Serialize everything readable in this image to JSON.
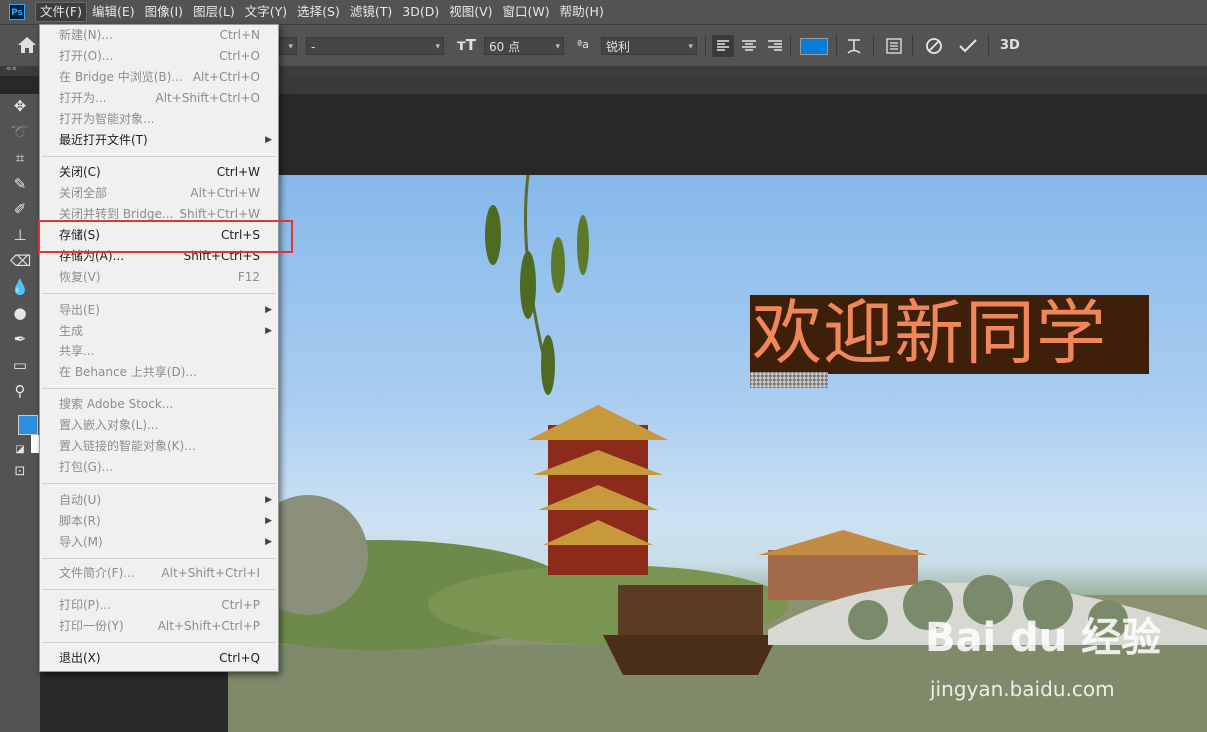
{
  "app": {
    "logo_text": "Ps"
  },
  "menubar": {
    "items": [
      "文件(F)",
      "编辑(E)",
      "图像(I)",
      "图层(L)",
      "文字(Y)",
      "选择(S)",
      "滤镜(T)",
      "3D(D)",
      "视图(V)",
      "窗口(W)",
      "帮助(H)"
    ]
  },
  "options_bar": {
    "font_style_value": "-",
    "font_size_value": "60 点",
    "aa_label": "ªa",
    "antialias_value": "锐利",
    "threed_label": "3D",
    "text_color": "#0a7bd4"
  },
  "file_menu": {
    "items": [
      {
        "label": "新建(N)...",
        "shortcut": "Ctrl+N",
        "enabled": false
      },
      {
        "label": "打开(O)...",
        "shortcut": "Ctrl+O",
        "enabled": false
      },
      {
        "label": "在 Bridge 中浏览(B)...",
        "shortcut": "Alt+Ctrl+O",
        "enabled": false
      },
      {
        "label": "打开为...",
        "shortcut": "Alt+Shift+Ctrl+O",
        "enabled": false
      },
      {
        "label": "打开为智能对象...",
        "shortcut": "",
        "enabled": false
      },
      {
        "label": "最近打开文件(T)",
        "shortcut": "",
        "enabled": true,
        "submenu": true
      },
      {
        "label": "关闭(C)",
        "shortcut": "Ctrl+W",
        "enabled": true
      },
      {
        "label": "关闭全部",
        "shortcut": "Alt+Ctrl+W",
        "enabled": false
      },
      {
        "label": "关闭并转到 Bridge...",
        "shortcut": "Shift+Ctrl+W",
        "enabled": false
      },
      {
        "label": "存储(S)",
        "shortcut": "Ctrl+S",
        "enabled": true
      },
      {
        "label": "存储为(A)...",
        "shortcut": "Shift+Ctrl+S",
        "enabled": true
      },
      {
        "label": "恢复(V)",
        "shortcut": "F12",
        "enabled": false
      },
      {
        "label": "导出(E)",
        "shortcut": "",
        "enabled": false,
        "submenu": true
      },
      {
        "label": "生成",
        "shortcut": "",
        "enabled": false,
        "submenu": true
      },
      {
        "label": "共享...",
        "shortcut": "",
        "enabled": false
      },
      {
        "label": "在 Behance 上共享(D)...",
        "shortcut": "",
        "enabled": false
      },
      {
        "label": "搜索 Adobe Stock...",
        "shortcut": "",
        "enabled": false
      },
      {
        "label": "置入嵌入对象(L)...",
        "shortcut": "",
        "enabled": false
      },
      {
        "label": "置入链接的智能对象(K)...",
        "shortcut": "",
        "enabled": false
      },
      {
        "label": "打包(G)...",
        "shortcut": "",
        "enabled": false
      },
      {
        "label": "自动(U)",
        "shortcut": "",
        "enabled": false,
        "submenu": true
      },
      {
        "label": "脚本(R)",
        "shortcut": "",
        "enabled": false,
        "submenu": true
      },
      {
        "label": "导入(M)",
        "shortcut": "",
        "enabled": false,
        "submenu": true
      },
      {
        "label": "文件简介(F)...",
        "shortcut": "Alt+Shift+Ctrl+I",
        "enabled": false
      },
      {
        "label": "打印(P)...",
        "shortcut": "Ctrl+P",
        "enabled": false
      },
      {
        "label": "打印一份(Y)",
        "shortcut": "Alt+Shift+Ctrl+P",
        "enabled": false
      },
      {
        "label": "退出(X)",
        "shortcut": "Ctrl+Q",
        "enabled": true
      }
    ]
  },
  "canvas": {
    "headline": "欢迎新同学"
  },
  "watermark": {
    "brand": "Bai du 经验",
    "url": "jingyan.baidu.com"
  },
  "colors": {
    "foreground": "#2e8fe0",
    "background": "#ffffff",
    "highlight": "#e53333"
  }
}
